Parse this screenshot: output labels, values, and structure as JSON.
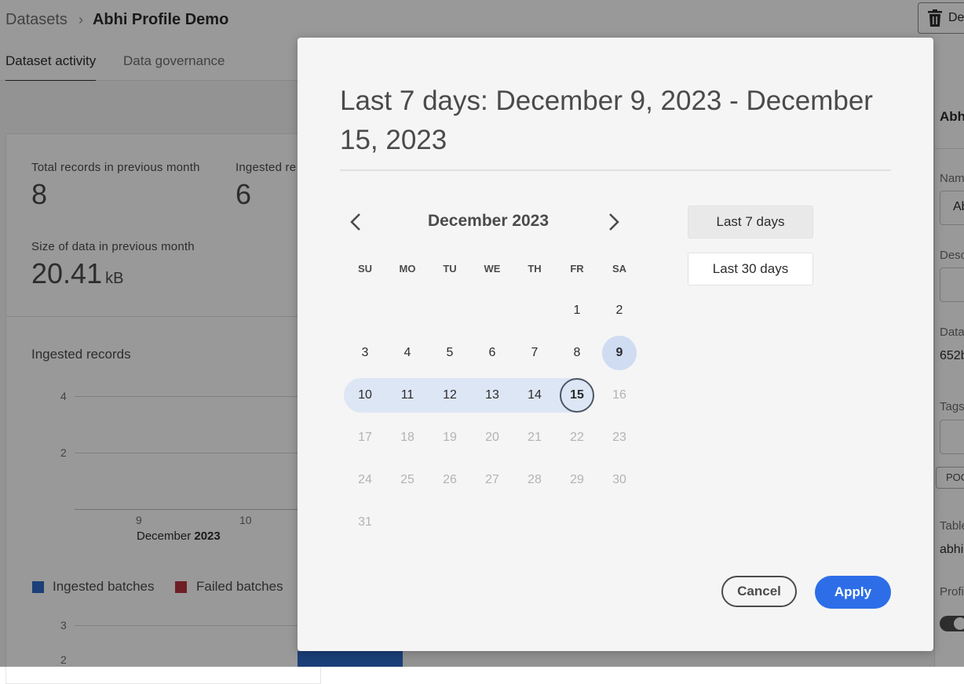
{
  "breadcrumb": {
    "root": "Datasets",
    "separator": "›",
    "current": "Abhi Profile Demo"
  },
  "header": {
    "delete_label": "De"
  },
  "tabs": [
    {
      "label": "Dataset activity"
    },
    {
      "label": "Data governance"
    }
  ],
  "stats": {
    "total_records_label": "Total records in previous month",
    "total_records_value": "8",
    "ingested_records_label": "Ingested re",
    "ingested_records_value": "6",
    "size_label": "Size of data in previous month",
    "size_value": "20.41",
    "size_unit": "kB"
  },
  "ingested_chart": {
    "title": "Ingested records",
    "y_ticks": [
      "4",
      "2"
    ],
    "x_ticks": [
      "9",
      "10"
    ],
    "x_month": "December",
    "x_year": "2023"
  },
  "legend": {
    "ingested_label": "Ingested batches",
    "ingested_color": "#2d6ac8",
    "failed_label": "Failed batches",
    "failed_color": "#b8323d"
  },
  "batch_chart": {
    "y_ticks": [
      "3",
      "2"
    ]
  },
  "right_panel": {
    "title": "Abh",
    "name_label": "Nam",
    "name_value": "Ab",
    "desc_label": "Desc",
    "dataset_label": "Datas",
    "dataset_value": "652b",
    "tags_label": "Tags",
    "tag_chip": "POC",
    "table_label": "Table",
    "table_value": "abhi",
    "profile_label": "Profil"
  },
  "dialog": {
    "title": "Last 7 days: December 9, 2023 - December 15, 2023",
    "month_label": "December 2023",
    "weekdays": [
      "SU",
      "MO",
      "TU",
      "WE",
      "TH",
      "FR",
      "SA"
    ],
    "weeks": [
      [
        "",
        "",
        "",
        "",
        "",
        "1",
        "2"
      ],
      [
        "3",
        "4",
        "5",
        "6",
        "7",
        "8",
        "9"
      ],
      [
        "10",
        "11",
        "12",
        "13",
        "14",
        "15",
        "16"
      ],
      [
        "17",
        "18",
        "19",
        "20",
        "21",
        "22",
        "23"
      ],
      [
        "24",
        "25",
        "26",
        "27",
        "28",
        "29",
        "30"
      ],
      [
        "31",
        "",
        "",
        "",
        "",
        "",
        ""
      ]
    ],
    "range_start": "9",
    "range_end": "15",
    "presets": {
      "last7": "Last 7 days",
      "last30": "Last 30 days"
    },
    "cancel_label": "Cancel",
    "apply_label": "Apply"
  },
  "colors": {
    "accent": "#2d6ee8",
    "range_fill": "#dde6f4"
  }
}
